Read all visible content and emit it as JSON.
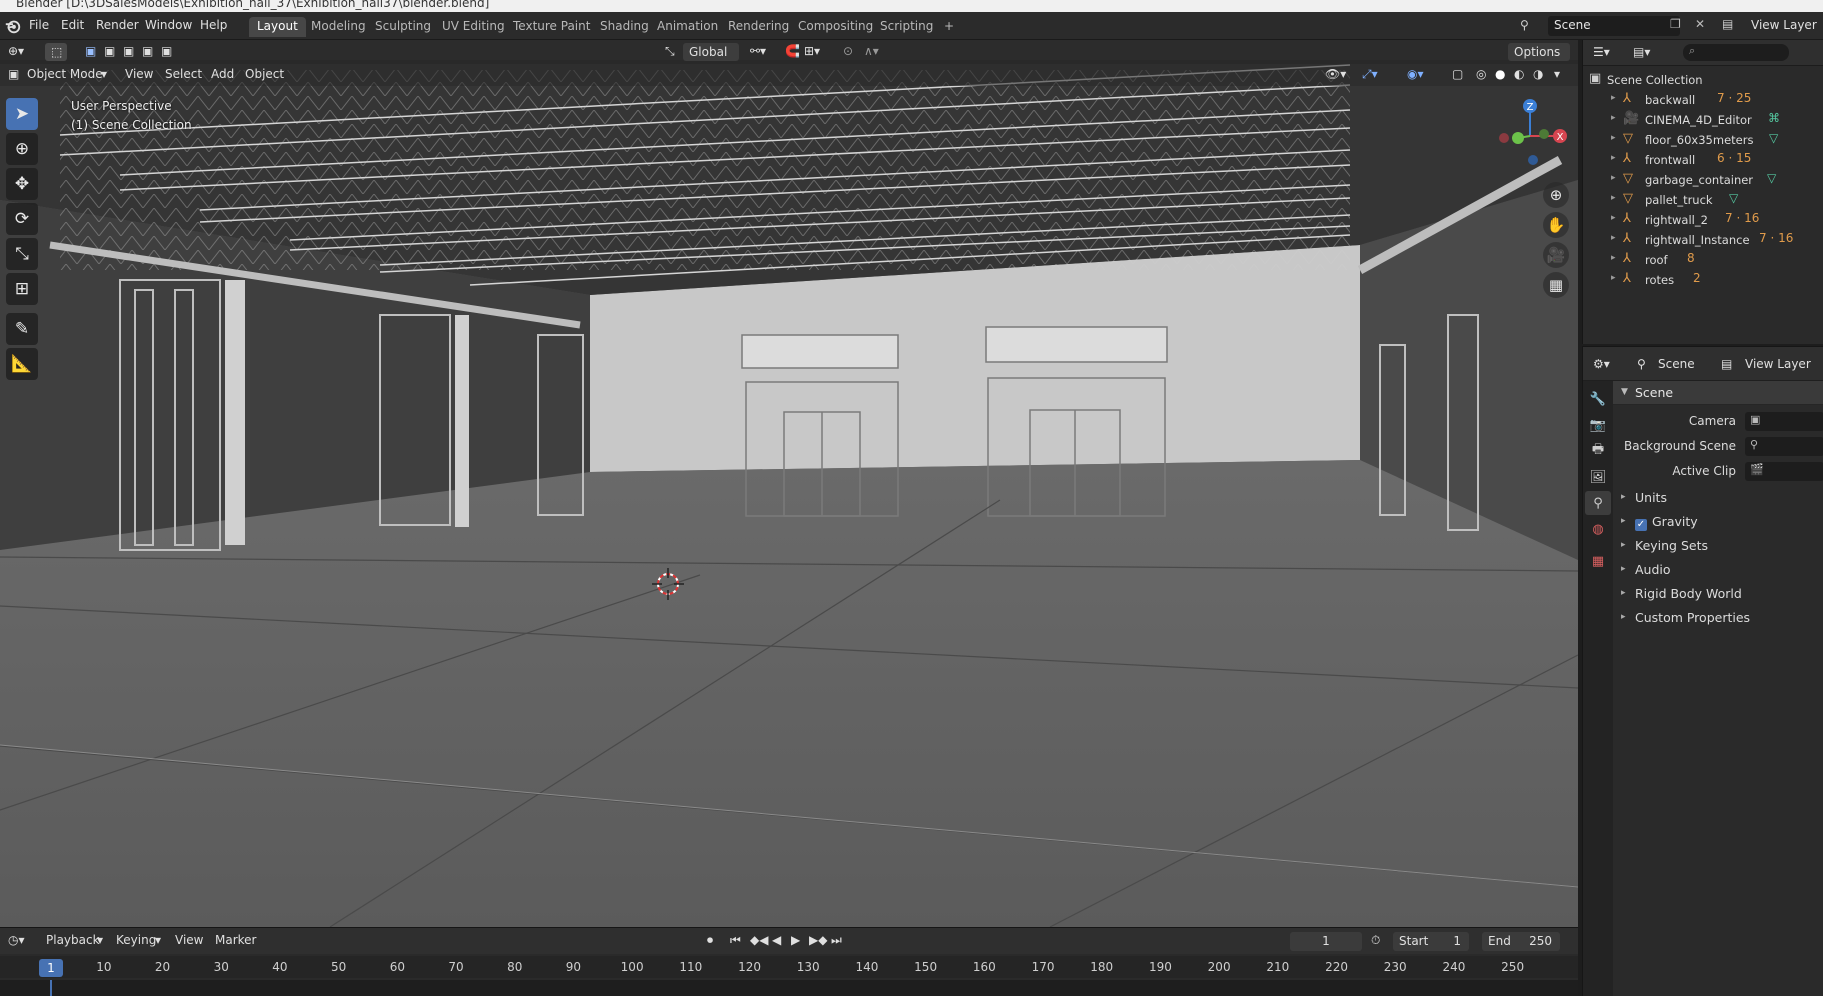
{
  "window": {
    "title": "Blender [D:\\3DSalesModels\\Exhibition_hall_37\\Exhibition_hall37\\blender.blend]"
  },
  "menu": [
    "File",
    "Edit",
    "Render",
    "Window",
    "Help"
  ],
  "workspaces": [
    "Layout",
    "Modeling",
    "Sculpting",
    "UV Editing",
    "Texture Paint",
    "Shading",
    "Animation",
    "Rendering",
    "Compositing",
    "Scripting"
  ],
  "add_workspace": "+",
  "scene_selector": "Scene",
  "view_layer_selector": "View Layer",
  "viewport": {
    "transform_orientation": "Global",
    "options_label": "Options",
    "mode": "Object Mode",
    "menus": [
      "View",
      "Select",
      "Add",
      "Object"
    ],
    "overlay_line1": "User Perspective",
    "overlay_line2": "(1) Scene Collection"
  },
  "gizmo": {
    "z": "Z",
    "x": "X",
    "y": "Y"
  },
  "outliner": {
    "search_placeholder": "",
    "root": "Scene Collection",
    "items": [
      {
        "name": "backwall",
        "badges": "7 · 25"
      },
      {
        "name": "CINEMA_4D_Editor",
        "badges": ""
      },
      {
        "name": "floor_60x35meters",
        "badges": ""
      },
      {
        "name": "frontwall",
        "badges": "6 · 15"
      },
      {
        "name": "garbage_container",
        "badges": ""
      },
      {
        "name": "pallet_truck",
        "badges": ""
      },
      {
        "name": "rightwall_2",
        "badges": "7 · 16"
      },
      {
        "name": "rightwall_Instance",
        "badges": "7 · 16"
      },
      {
        "name": "roof",
        "badges": "8"
      },
      {
        "name": "rotes",
        "badges": "2"
      }
    ]
  },
  "properties": {
    "header_scene": "Scene",
    "header_view_layer": "View Layer",
    "panel_title": "Scene",
    "fields": [
      {
        "label": "Camera"
      },
      {
        "label": "Background Scene"
      },
      {
        "label": "Active Clip"
      }
    ],
    "subpanels": [
      "Units",
      "Gravity",
      "Keying Sets",
      "Audio",
      "Rigid Body World",
      "Custom Properties"
    ]
  },
  "timeline": {
    "menus": [
      "Playback",
      "Keying",
      "View",
      "Marker"
    ],
    "current_frame": "1",
    "start_label": "Start",
    "start_value": "1",
    "end_label": "End",
    "end_value": "250",
    "ruler": [
      "1",
      "10",
      "20",
      "30",
      "40",
      "50",
      "60",
      "70",
      "80",
      "90",
      "100",
      "110",
      "120",
      "130",
      "140",
      "150",
      "160",
      "170",
      "180",
      "190",
      "200",
      "210",
      "220",
      "230",
      "240",
      "250"
    ]
  },
  "colors": {
    "accent": "#4772b3",
    "object_icon": "#e09b4b",
    "mesh_icon": "#55c8a0"
  }
}
